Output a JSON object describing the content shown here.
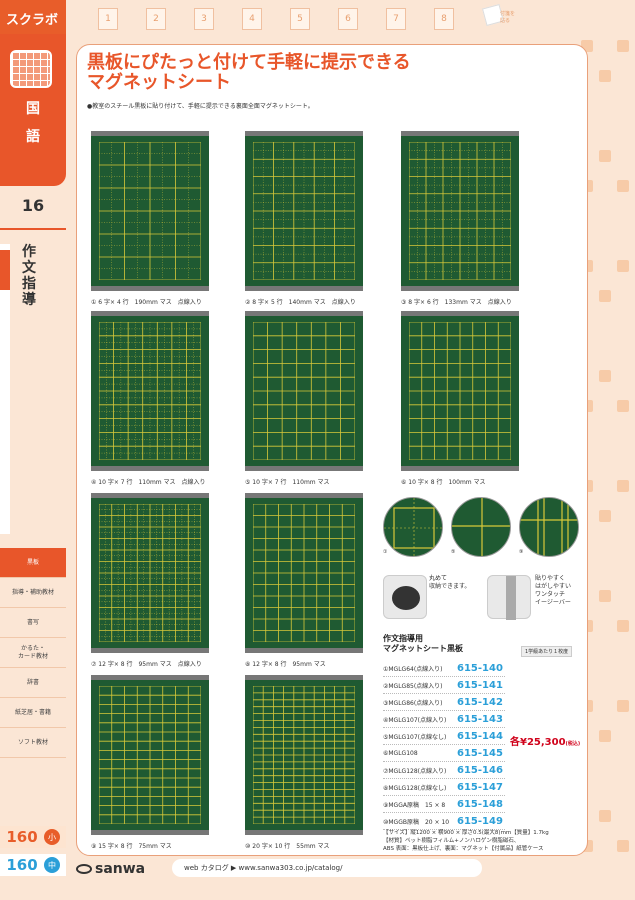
{
  "brand": "スクラボ",
  "subject": [
    "国",
    "語"
  ],
  "side_page": "16",
  "section": "作文指導",
  "side_menu": [
    "黒板",
    "指導・補助教材",
    "書写",
    "かるた・\nカード教材",
    "辞書",
    "紙芝居・書籍",
    "ソフト教材"
  ],
  "footer_pages": [
    {
      "num": "160",
      "badge": "小"
    },
    {
      "num": "160",
      "badge": "中"
    }
  ],
  "tabs": [
    "1",
    "2",
    "3",
    "4",
    "5",
    "6",
    "7",
    "8"
  ],
  "tab_memo": "付箋を\n貼る",
  "headline": [
    "黒板にぴたっと付けて手軽に提示できる",
    "マグネットシート"
  ],
  "lead": "●教室のスチール黒板に貼り付けて、手軽に提示できる裏面全面マグネットシート。",
  "boards": [
    {
      "caption": "① 6 字× 4 行　190mm マス　点線入り",
      "cols": 4,
      "rows": 6,
      "dotted": true
    },
    {
      "caption": "② 8 字× 5 行　140mm マス　点線入り",
      "cols": 5,
      "rows": 8,
      "dotted": true
    },
    {
      "caption": "③ 8 字× 6 行　133mm マス　点線入り",
      "cols": 6,
      "rows": 8,
      "dotted": true
    },
    {
      "caption": "④ 10 字× 7 行　110mm マス　点線入り",
      "cols": 7,
      "rows": 10,
      "dotted": true
    },
    {
      "caption": "⑤ 10 字× 7 行　110mm マス",
      "cols": 7,
      "rows": 10,
      "dotted": false
    },
    {
      "caption": "⑥ 10 字× 8 行　100mm マス",
      "cols": 8,
      "rows": 10,
      "dotted": false
    },
    {
      "caption": "⑦ 12 字× 8 行　95mm マス　点線入り",
      "cols": 8,
      "rows": 12,
      "dotted": true
    },
    {
      "caption": "⑧ 12 字× 8 行　95mm マス",
      "cols": 8,
      "rows": 12,
      "dotted": false
    },
    {
      "caption": "⑨ 15 字× 8 行　75mm マス",
      "cols": 8,
      "rows": 15,
      "dotted": false
    },
    {
      "caption": "⑩ 20 字× 10 行　55mm マス",
      "cols": 10,
      "rows": 20,
      "dotted": false
    }
  ],
  "circles": [
    "①",
    "⑤",
    "⑨"
  ],
  "photo_notes": [
    "丸めて\n収納できます。",
    "貼りやすく\nはがしやすい\nワンタッチ\nイージーバー"
  ],
  "product_title": [
    "作文指導用",
    "マグネットシート黒板"
  ],
  "per_grade": "1学級あたり１枚度",
  "products": [
    {
      "model": "①MGLG64(点線入り)",
      "code": "615-140"
    },
    {
      "model": "②MGLG85(点線入り)",
      "code": "615-141"
    },
    {
      "model": "③MGLG86(点線入り)",
      "code": "615-142"
    },
    {
      "model": "④MGLG107(点線入り)",
      "code": "615-143"
    },
    {
      "model": "⑤MGLG107(点線なし)",
      "code": "615-144"
    },
    {
      "model": "⑥MGLG108",
      "code": "615-145"
    },
    {
      "model": "⑦MGLG128(点線入り)",
      "code": "615-146"
    },
    {
      "model": "⑧MGLG128(点線なし)",
      "code": "615-147"
    },
    {
      "model": "⑨MGGA原稿　15 × 8",
      "code": "615-148"
    },
    {
      "model": "⑩MGGB原稿　20 × 10",
      "code": "615-149"
    }
  ],
  "price": "各¥25,300",
  "price_tax": "(税込)",
  "specs": [
    "【サイズ】縦1200 × 横900 × 厚さ0.5(最大8)mm【質量】1.7kg",
    "【材質】ペット樹脂フィルム+ノンハロゲン樹脂磁石、",
    "ABS 表面：黒板仕上げ、裏面：マグネット【付属品】紙管ケース"
  ],
  "logo": "sanwa",
  "web": "web カタログ ▶ www.sanwa303.co.jp/catalog/",
  "colors": {
    "accent": "#e8562a",
    "board": "#1f5a32",
    "grid": "#d8c93a",
    "code": "#2b9fd8",
    "price": "#d0021b"
  }
}
